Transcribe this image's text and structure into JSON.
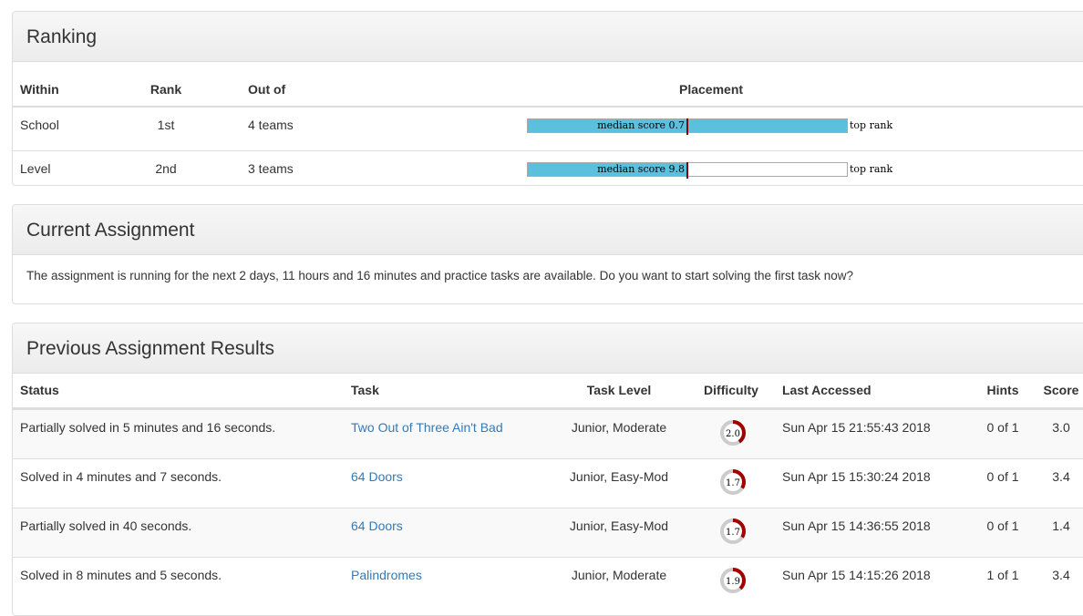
{
  "ranking": {
    "title": "Ranking",
    "headers": {
      "within": "Within",
      "rank": "Rank",
      "out_of": "Out of",
      "placement": "Placement"
    },
    "rows": [
      {
        "within": "School",
        "rank": "1st",
        "out_of": "4 teams",
        "median_label": "median score 0.7",
        "median_fraction": 0.5,
        "fill_fraction": 1.0,
        "top_label": "top rank"
      },
      {
        "within": "Level",
        "rank": "2nd",
        "out_of": "3 teams",
        "median_label": "median score 9.8",
        "median_fraction": 0.5,
        "fill_fraction": 0.5,
        "top_label": "top rank"
      }
    ],
    "colors": {
      "bar": "#5bc0de",
      "median_line": "#8b0000"
    }
  },
  "current": {
    "title": "Current Assignment",
    "text": "The assignment is running for the next 2 days, 11 hours and 16 minutes and practice tasks are available. Do you want to start solving the first task now?"
  },
  "previous": {
    "title": "Previous Assignment Results",
    "headers": {
      "status": "Status",
      "task": "Task",
      "level": "Task Level",
      "difficulty": "Difficulty",
      "last": "Last Accessed",
      "hints": "Hints",
      "score": "Score"
    },
    "rows": [
      {
        "status": "Partially solved in 5 minutes and 16 seconds.",
        "task": "Two Out of Three Ain't Bad",
        "level": "Junior, Moderate",
        "difficulty": "2.0",
        "difficulty_fraction": 0.4,
        "last": "Sun Apr 15 21:55:43 2018",
        "hints": "0 of 1",
        "score": "3.0"
      },
      {
        "status": "Solved in 4 minutes and 7 seconds.",
        "task": "64 Doors",
        "level": "Junior, Easy-Mod",
        "difficulty": "1.7",
        "difficulty_fraction": 0.34,
        "last": "Sun Apr 15 15:30:24 2018",
        "hints": "0 of 1",
        "score": "3.4"
      },
      {
        "status": "Partially solved in 40 seconds.",
        "task": "64 Doors",
        "level": "Junior, Easy-Mod",
        "difficulty": "1.7",
        "difficulty_fraction": 0.34,
        "last": "Sun Apr 15 14:36:55 2018",
        "hints": "0 of 1",
        "score": "1.4"
      },
      {
        "status": "Solved in 8 minutes and 5 seconds.",
        "task": "Palindromes",
        "level": "Junior, Moderate",
        "difficulty": "1.9",
        "difficulty_fraction": 0.38,
        "last": "Sun Apr 15 14:15:26 2018",
        "hints": "1 of 1",
        "score": "3.4"
      }
    ],
    "colors": {
      "link": "#337ab7",
      "gauge_fill": "#a00000",
      "gauge_track": "#cccccc"
    }
  }
}
